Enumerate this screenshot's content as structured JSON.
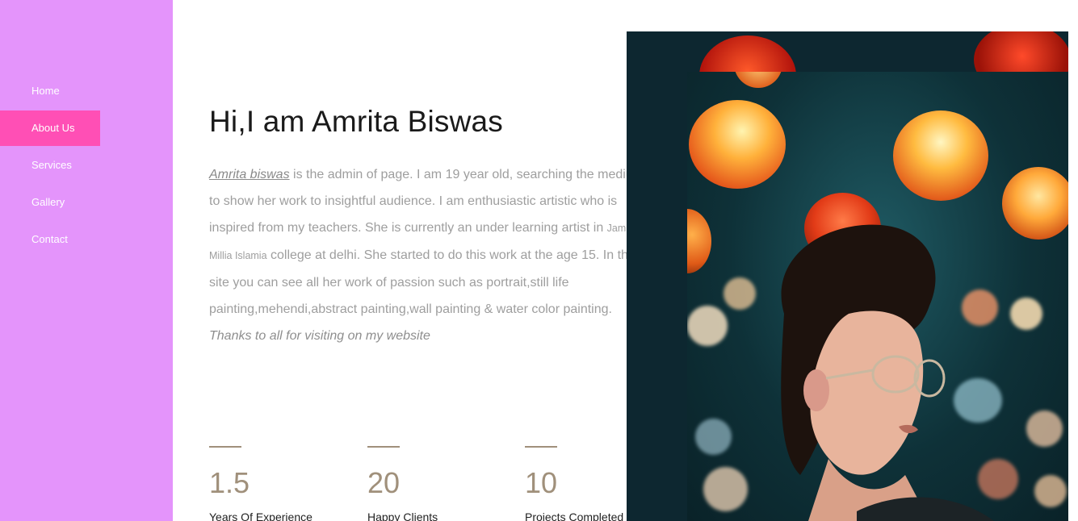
{
  "sidebar": {
    "items": [
      {
        "label": "Home",
        "active": false
      },
      {
        "label": "About Us",
        "active": true
      },
      {
        "label": "Services",
        "active": false
      },
      {
        "label": "Gallery",
        "active": false
      },
      {
        "label": "Contact",
        "active": false
      }
    ],
    "background_color": "#e494fb",
    "active_color": "#ff4fb5"
  },
  "main": {
    "title": "Hi,I am Amrita Biswas",
    "about": {
      "name_link": "Amrita biswas",
      "text_1": " is the admin of page. I am 19 year old, searching the medium to show her work to insightful audience. I am enthusiastic artistic who is inspired from my teachers. She is currently an under learning artist in ",
      "college": "Jamia Millia Islamia",
      "text_2": " college at delhi. She started to do this work at the age 15. In this site you can see all her work of passion such as portrait,still life painting,mehendi,abstract painting,wall painting & water color painting.",
      "thanks": "Thanks to all for visiting on my website"
    },
    "stats": [
      {
        "value": "1.5",
        "label": "Years Of Experience"
      },
      {
        "value": "20",
        "label": "Happy Clients"
      },
      {
        "value": "10",
        "label": "Projects Completed"
      }
    ],
    "accent_color": "#a0907b"
  },
  "photo": {
    "icon": "portrait-photo-lanterns"
  }
}
